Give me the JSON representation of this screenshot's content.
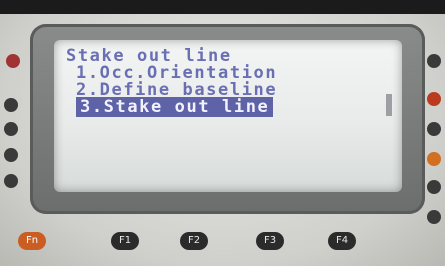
{
  "screen": {
    "title": "Stake out line",
    "menu_items": [
      "1.Occ.Orientation",
      "2.Define baseline",
      "3.Stake out line"
    ],
    "selected_index": 2
  },
  "keys": {
    "fn": "Fn",
    "f1": "F1",
    "f2": "F2",
    "f3": "F3",
    "f4": "F4"
  }
}
